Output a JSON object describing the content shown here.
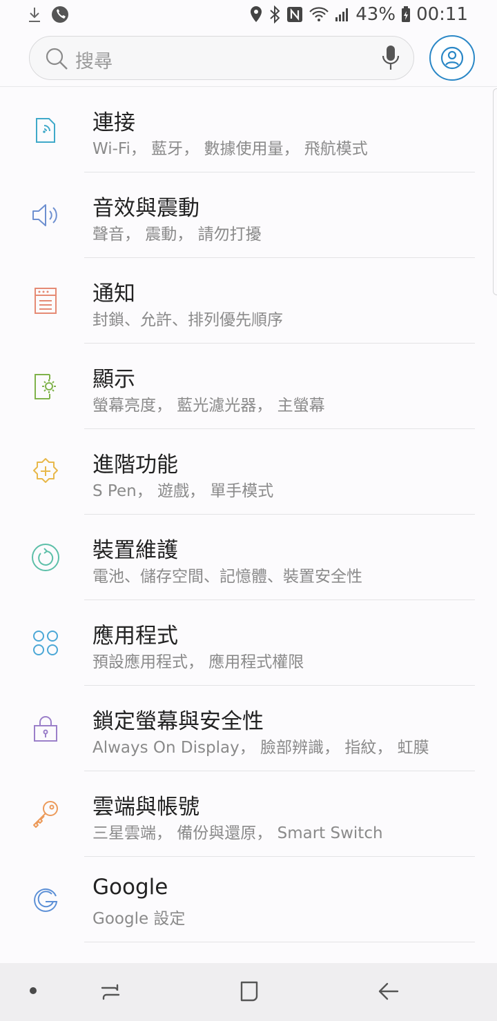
{
  "status_bar": {
    "battery": "43%",
    "time": "00:11",
    "icons": [
      "download-icon",
      "phone-icon",
      "location-icon",
      "bluetooth-icon",
      "nfc-icon",
      "wifi-icon",
      "signal-icon",
      "battery-icon"
    ]
  },
  "search": {
    "placeholder": "搜尋"
  },
  "items": [
    {
      "title": "連接",
      "subtitle": "Wi-Fi， 藍牙， 數據使用量， 飛航模式",
      "icon": "connections-icon",
      "color": "#3fa9c9"
    },
    {
      "title": "音效與震動",
      "subtitle": "聲音， 震動， 請勿打擾",
      "icon": "sound-icon",
      "color": "#6d8fd0"
    },
    {
      "title": "通知",
      "subtitle": "封鎖、允許、排列優先順序",
      "icon": "notifications-icon",
      "color": "#e58a74"
    },
    {
      "title": "顯示",
      "subtitle": "螢幕亮度， 藍光濾光器， 主螢幕",
      "icon": "display-icon",
      "color": "#7fb24a"
    },
    {
      "title": "進階功能",
      "subtitle": "S Pen， 遊戲， 單手模式",
      "icon": "advanced-features-icon",
      "color": "#e8b84a"
    },
    {
      "title": "裝置維護",
      "subtitle": "電池、儲存空間、記憶體、裝置安全性",
      "icon": "device-maintenance-icon",
      "color": "#5cbfa8"
    },
    {
      "title": "應用程式",
      "subtitle": "預設應用程式， 應用程式權限",
      "icon": "apps-icon",
      "color": "#4ba7d6"
    },
    {
      "title": "鎖定螢幕與安全性",
      "subtitle": "Always On Display， 臉部辨識， 指紋， 虹膜",
      "icon": "lock-icon",
      "color": "#9b7fc9"
    },
    {
      "title": "雲端與帳號",
      "subtitle": "三星雲端， 備份與還原， Smart Switch",
      "icon": "key-icon",
      "color": "#ec9a5a"
    },
    {
      "title": "Google",
      "subtitle": "Google 設定",
      "icon": "google-icon",
      "color": "#5b8fd6"
    }
  ],
  "nav": {
    "buttons": [
      "recents-icon",
      "home-icon",
      "back-icon"
    ]
  }
}
